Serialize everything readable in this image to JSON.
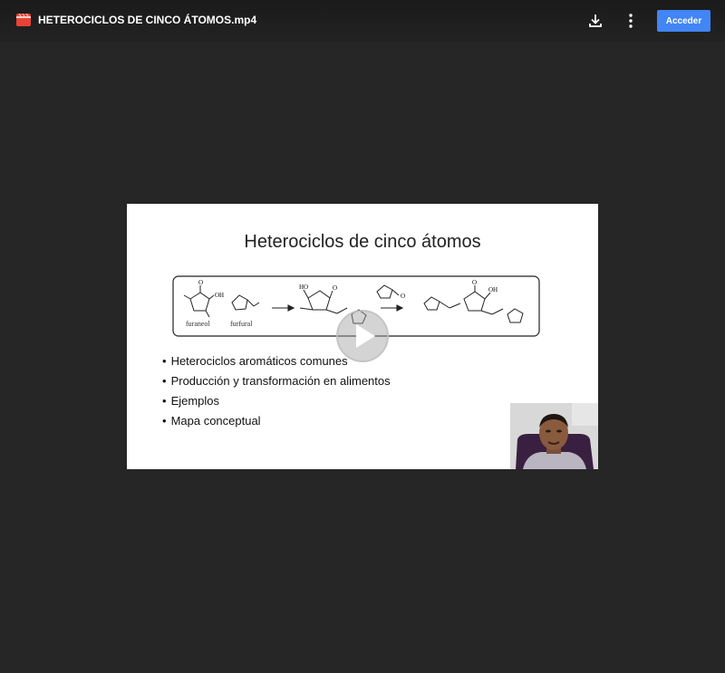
{
  "header": {
    "file_name": "HETEROCICLOS DE CINCO ÁTOMOS.mp4",
    "file_icon": "video-file-icon",
    "download_icon": "download-icon",
    "more_icon": "more-vert-icon",
    "signin_label": "Acceder",
    "signin_color": "#4285f4"
  },
  "slide": {
    "title": "Heterociclos de cinco átomos",
    "scheme": {
      "labels": [
        "furaneol",
        "furfural",
        "O",
        "OH",
        "HO",
        "O",
        "O",
        "O",
        "OH"
      ]
    },
    "bullets": [
      "Heterociclos aromáticos comunes",
      "Producción y transformación en alimentos",
      "Ejemplos",
      "Mapa conceptual"
    ]
  },
  "player": {
    "play_icon": "play-icon",
    "webcam_icon": "presenter-video"
  }
}
